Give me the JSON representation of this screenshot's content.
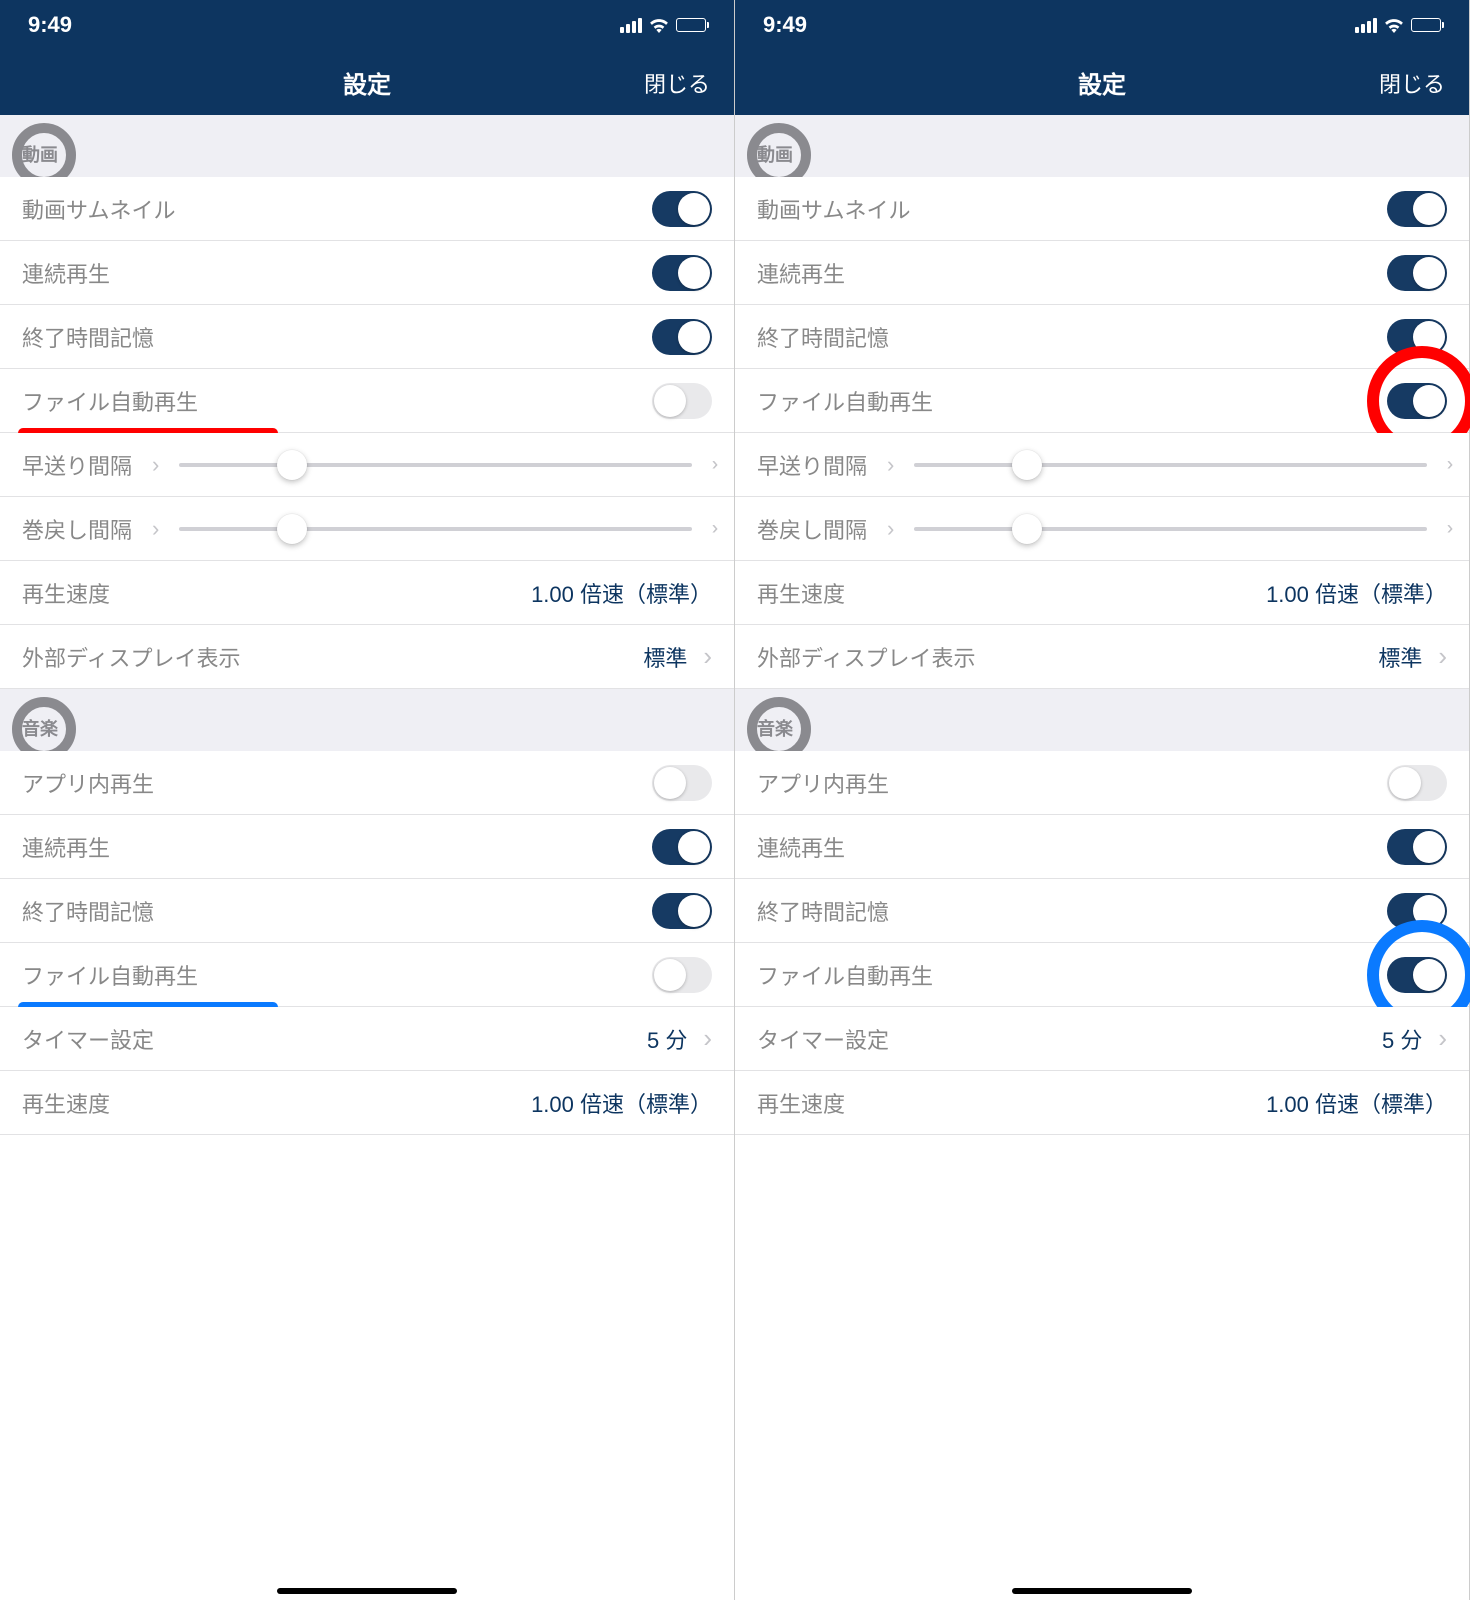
{
  "status": {
    "time": "9:49"
  },
  "nav": {
    "title": "設定",
    "close": "閉じる"
  },
  "sections": {
    "video": {
      "header": "動画",
      "rows": {
        "thumbnail": "動画サムネイル",
        "continuous": "連続再生",
        "remember_end": "終了時間記憶",
        "autoplay": "ファイル自動再生",
        "ff_interval": "早送り間隔",
        "rw_interval": "巻戻し間隔",
        "speed": "再生速度",
        "speed_value": "1.00 倍速（標準）",
        "external_display": "外部ディスプレイ表示",
        "external_display_value": "標準"
      }
    },
    "music": {
      "header": "音楽",
      "rows": {
        "in_app": "アプリ内再生",
        "continuous": "連続再生",
        "remember_end": "終了時間記憶",
        "autoplay": "ファイル自動再生",
        "timer": "タイマー設定",
        "timer_value": "5 分",
        "speed": "再生速度",
        "speed_value": "1.00 倍速（標準）"
      }
    }
  },
  "screens": {
    "left": {
      "video_autoplay_on": false,
      "music_autoplay_on": false,
      "highlight_video_autoplay_underline": true,
      "highlight_music_autoplay_underline": true,
      "circle_video_toggle": false,
      "circle_music_toggle": false
    },
    "right": {
      "video_autoplay_on": true,
      "music_autoplay_on": true,
      "highlight_video_autoplay_underline": false,
      "highlight_music_autoplay_underline": false,
      "circle_video_toggle": true,
      "circle_music_toggle": true
    }
  }
}
